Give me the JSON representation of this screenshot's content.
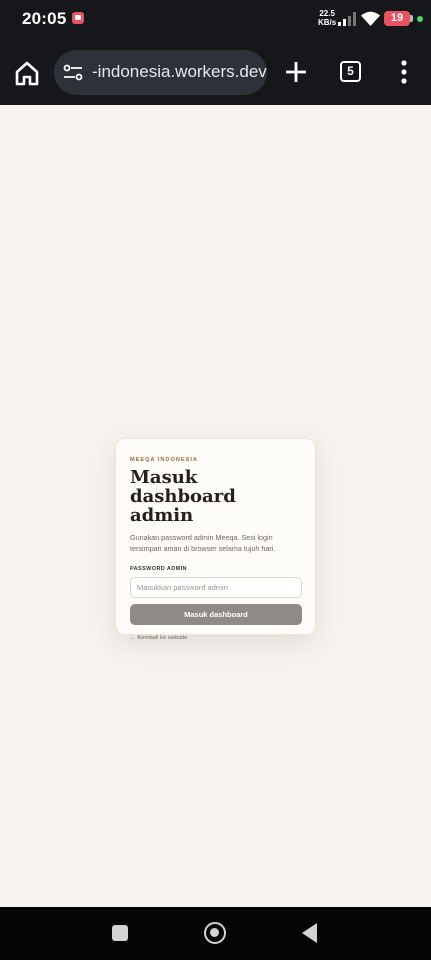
{
  "status_bar": {
    "time": "20:05",
    "net_speed_value": "22.5",
    "net_speed_unit": "KB/s",
    "battery_level": "19",
    "battery_color": "#e8535f",
    "charging_color": "#4ad66d"
  },
  "browser": {
    "url": "-indonesia.workers.dev",
    "tab_count": "5",
    "icons": [
      "home-icon",
      "tune-icon",
      "plus-icon",
      "tab-count-icon",
      "more-vert-icon"
    ]
  },
  "login": {
    "eyebrow": "MEEQA INDONESIA",
    "title": "Masuk dashboard admin",
    "description": "Gunakan password admin Meeqa. Sesi login tersimpan aman di browser selama tujuh hari.",
    "password_label": "PASSWORD ADMIN",
    "password_placeholder": "Masukkan password admin",
    "password_value": "",
    "submit_label": "Masuk dashboard",
    "back_link": "← Kembali ke website",
    "accent_color": "#a4683e",
    "button_color": "#8f8a86"
  },
  "nav_bar": {
    "icons": [
      "recent-apps-icon",
      "home-circle-icon",
      "back-triangle-icon"
    ]
  }
}
